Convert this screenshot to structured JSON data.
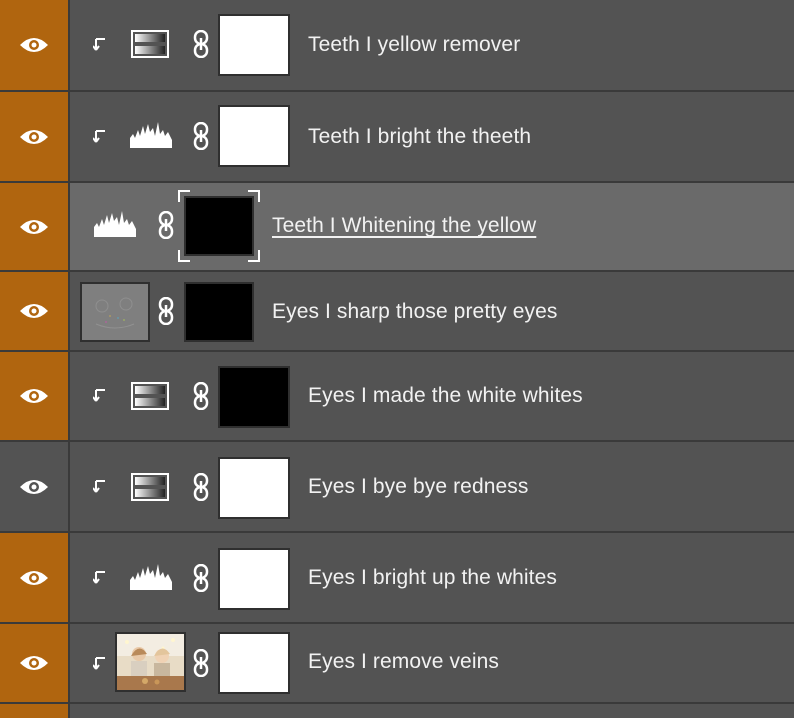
{
  "panel": "Layers",
  "colors": {
    "visibility_on": "#b0650f",
    "panel_bg": "#535353",
    "selected_bg": "#6a6a6a"
  },
  "layers": [
    {
      "name": "Teeth I yellow remover",
      "type": "gradient-map",
      "clipped": true,
      "mask": "white",
      "visibility_highlight": true
    },
    {
      "name": "Teeth I bright the theeth",
      "type": "levels",
      "clipped": true,
      "mask": "white",
      "visibility_highlight": true
    },
    {
      "name": "Teeth I Whitening the yellow",
      "type": "levels",
      "clipped": false,
      "mask": "black",
      "visibility_highlight": true,
      "selected": true
    },
    {
      "name": "Eyes I sharp those pretty eyes",
      "type": "high-pass-pixel",
      "clipped": false,
      "mask": "black",
      "visibility_highlight": true
    },
    {
      "name": "Eyes I made the white whites",
      "type": "gradient-map",
      "clipped": true,
      "mask": "black",
      "visibility_highlight": true
    },
    {
      "name": "Eyes I bye bye redness",
      "type": "gradient-map",
      "clipped": true,
      "mask": "white",
      "visibility_highlight": false
    },
    {
      "name": "Eyes I bright up the whites",
      "type": "levels",
      "clipped": true,
      "mask": "white",
      "visibility_highlight": true
    },
    {
      "name": "Eyes I remove veins",
      "type": "photo-pixel",
      "clipped": true,
      "mask": "white",
      "visibility_highlight": true
    }
  ]
}
